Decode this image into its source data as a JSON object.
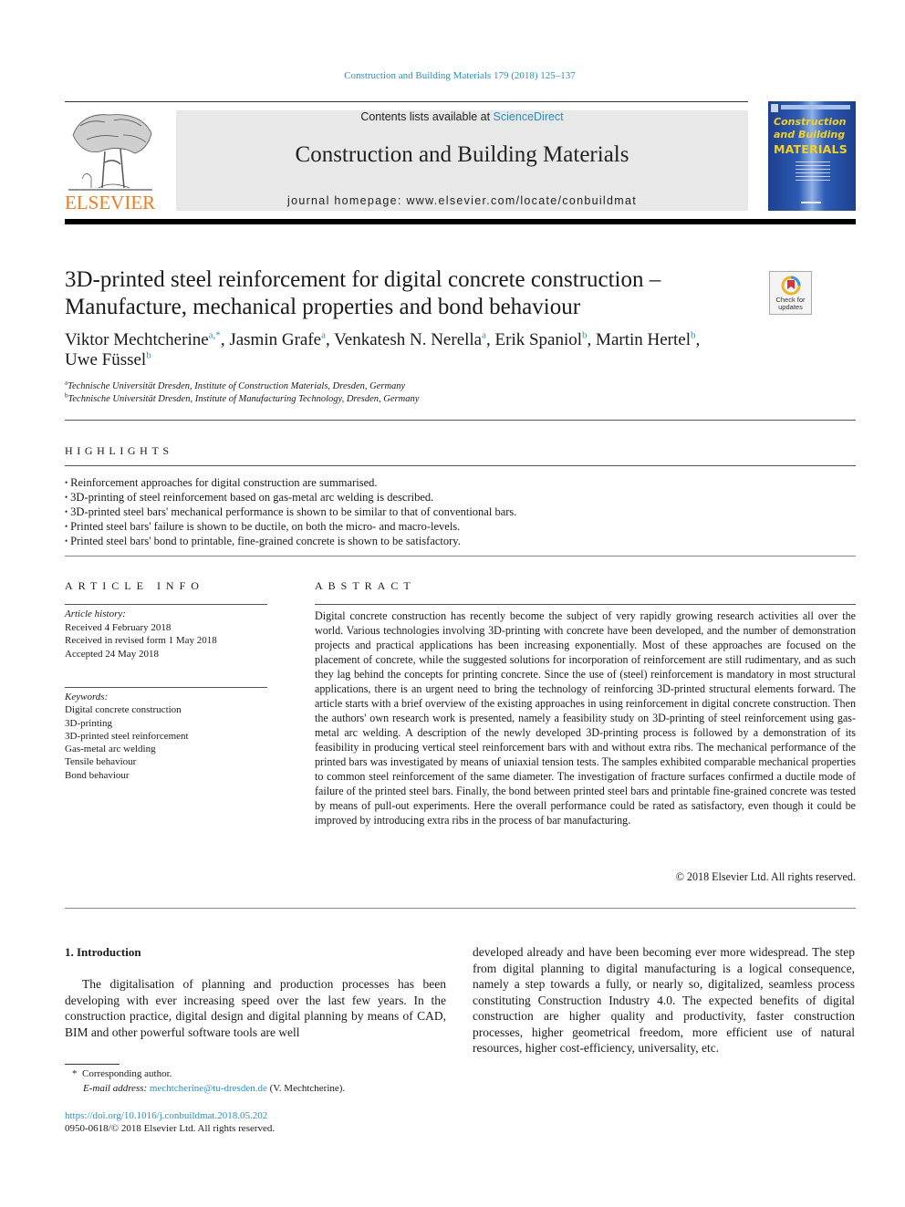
{
  "citation": "Construction and Building Materials 179 (2018) 125–137",
  "header": {
    "publisher_logo_text": "ELSEVIER",
    "contents_prefix": "Contents lists available at ",
    "contents_link": "ScienceDirect",
    "journal_title": "Construction and Building Materials",
    "homepage_prefix": "journal homepage: ",
    "homepage_url": "www.elsevier.com/locate/conbuildmat",
    "cover": {
      "line1": "Construction",
      "line2": "and Building",
      "line3": "MATERIALS",
      "colors": {
        "background": "#2d5bb5",
        "title": "#f5d21e"
      }
    }
  },
  "article": {
    "title": "3D-printed steel reinforcement for digital concrete construction – Manufacture, mechanical properties and bond behaviour",
    "check_updates": "Check for updates",
    "authors": [
      {
        "name": "Viktor Mechtcherine",
        "aff": "a,*"
      },
      {
        "name": "Jasmin Grafe",
        "aff": "a"
      },
      {
        "name": "Venkatesh N. Nerella",
        "aff": "a"
      },
      {
        "name": "Erik Spaniol",
        "aff": "b"
      },
      {
        "name": "Martin Hertel",
        "aff": "b"
      },
      {
        "name": "Uwe Füssel",
        "aff": "b"
      }
    ],
    "affiliations": [
      {
        "key": "a",
        "text": "Technische Universität Dresden, Institute of Construction Materials, Dresden, Germany"
      },
      {
        "key": "b",
        "text": "Technische Universität Dresden, Institute of Manufacturing Technology, Dresden, Germany"
      }
    ]
  },
  "highlights": {
    "heading": "HIGHLIGHTS",
    "items": [
      "Reinforcement approaches for digital construction are summarised.",
      "3D-printing of steel reinforcement based on gas-metal arc welding is described.",
      "3D-printed steel bars' mechanical performance is shown to be similar to that of conventional bars.",
      "Printed steel bars' failure is shown to be ductile, on both the micro- and macro-levels.",
      "Printed steel bars' bond to printable, fine-grained concrete is shown to be satisfactory."
    ]
  },
  "article_info": {
    "heading": "ARTICLE INFO",
    "history_label": "Article history:",
    "history": [
      "Received 4 February 2018",
      "Received in revised form 1 May 2018",
      "Accepted 24 May 2018"
    ],
    "keywords_label": "Keywords:",
    "keywords": [
      "Digital concrete construction",
      "3D-printing",
      "3D-printed steel reinforcement",
      "Gas-metal arc welding",
      "Tensile behaviour",
      "Bond behaviour"
    ]
  },
  "abstract": {
    "heading": "ABSTRACT",
    "text": "Digital concrete construction has recently become the subject of very rapidly growing research activities all over the world. Various technologies involving 3D-printing with concrete have been developed, and the number of demonstration projects and practical applications has been increasing exponentially. Most of these approaches are focused on the placement of concrete, while the suggested solutions for incorporation of reinforcement are still rudimentary, and as such they lag behind the concepts for print­ing concrete. Since the use of (steel) reinforcement is mandatory in most structural applications, there is an urgent need to bring the technology of reinforcing 3D-printed structural elements forward. The article starts with a brief overview of the existing approaches in using reinforcement in digital concrete con­struction. Then the authors' own research work is presented, namely a feasibility study on 3D-printing of steel reinforcement using gas-metal arc welding. A description of the newly developed 3D-printing process is followed by a demonstration of its feasibility in producing vertical steel reinforcement bars with and without extra ribs. The mechanical performance of the printed bars was investigated by means of uniaxial tension tests. The samples exhibited comparable mechanical properties to common steel rein­forcement of the same diameter. The investigation of fracture surfaces confirmed a ductile mode of fail­ure of the printed steel bars. Finally, the bond between printed steel bars and printable fine-grained concrete was tested by means of pull-out experiments. Here the overall performance could be rated as satisfactory, even though it could be improved by introducing extra ribs in the process of bar manufacturing.",
    "copyright": "© 2018 Elsevier Ltd. All rights reserved."
  },
  "introduction": {
    "heading": "1. Introduction",
    "col1": "The digitalisation of planning and production processes has been developing with ever increasing speed over the last few years. In the construction practice, digital design and digital planning by means of CAD, BIM and other powerful software tools are well",
    "col2": "developed already and have been becoming ever more widespread. The step from digital planning to digital manufacturing is a logical consequence, namely a step towards a fully, or nearly so, digital­ized, seamless process constituting Construction Industry 4.0. The expected benefits of digital construction are higher quality and productivity, faster construction processes, higher geometrical freedom, more efficient use of natural resources, higher cost-efficiency, universality, etc."
  },
  "footnotes": {
    "corresponding_marker": "*",
    "corresponding": "Corresponding author.",
    "email_label": "E-mail address: ",
    "email": "mechtcherine@tu-dresden.de",
    "email_suffix": " (V. Mechtcherine).",
    "doi": "https://doi.org/10.1016/j.conbuildmat.2018.05.202",
    "issn": "0950-0618/© 2018 Elsevier Ltd. All rights reserved."
  },
  "colors": {
    "link": "#2b8fb8",
    "elsevier_orange": "#f07b1f",
    "header_box": "#e8e8e8"
  }
}
